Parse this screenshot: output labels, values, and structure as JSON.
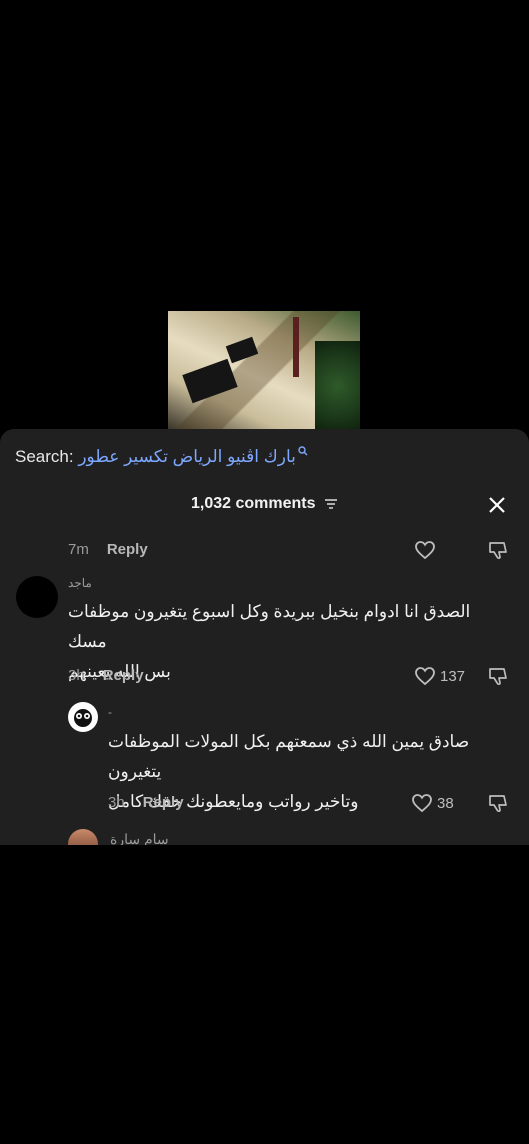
{
  "search": {
    "prefix": "Search:",
    "query": "بارك اڤنيو الرياض تكسير عطور"
  },
  "header": {
    "comment_count": "1,032 comments"
  },
  "top_meta": {
    "time": "7m",
    "reply": "Reply"
  },
  "comments": [
    {
      "username": "ماجد",
      "line1": "الصدق انا ادوام بنخيل ببريدة وكل اسبوع يتغيرون موظفات مسك",
      "line2": "بس الله يعينهم",
      "time": "3h",
      "reply": "Reply",
      "likes": "137"
    },
    {
      "username": "-",
      "line1": "صادق يمين الله ذي سمعتهم بكل المولات الموظفات يتغيرون",
      "line2": "وتاخير رواتب ومايعطونك حقك كامل",
      "time": "3h",
      "reply": "Reply",
      "likes": "38"
    }
  ],
  "partial_next": {
    "username": "سام سارة"
  },
  "colors": {
    "panel": "#202020",
    "link": "#7ea8ff",
    "background": "#000000"
  }
}
